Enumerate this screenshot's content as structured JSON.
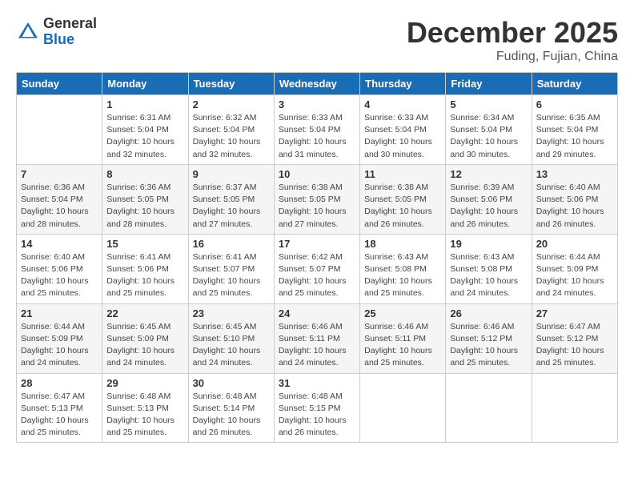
{
  "logo": {
    "general": "General",
    "blue": "Blue"
  },
  "title": "December 2025",
  "subtitle": "Fuding, Fujian, China",
  "days_of_week": [
    "Sunday",
    "Monday",
    "Tuesday",
    "Wednesday",
    "Thursday",
    "Friday",
    "Saturday"
  ],
  "weeks": [
    [
      {
        "day": "",
        "info": ""
      },
      {
        "day": "1",
        "info": "Sunrise: 6:31 AM\nSunset: 5:04 PM\nDaylight: 10 hours\nand 32 minutes."
      },
      {
        "day": "2",
        "info": "Sunrise: 6:32 AM\nSunset: 5:04 PM\nDaylight: 10 hours\nand 32 minutes."
      },
      {
        "day": "3",
        "info": "Sunrise: 6:33 AM\nSunset: 5:04 PM\nDaylight: 10 hours\nand 31 minutes."
      },
      {
        "day": "4",
        "info": "Sunrise: 6:33 AM\nSunset: 5:04 PM\nDaylight: 10 hours\nand 30 minutes."
      },
      {
        "day": "5",
        "info": "Sunrise: 6:34 AM\nSunset: 5:04 PM\nDaylight: 10 hours\nand 30 minutes."
      },
      {
        "day": "6",
        "info": "Sunrise: 6:35 AM\nSunset: 5:04 PM\nDaylight: 10 hours\nand 29 minutes."
      }
    ],
    [
      {
        "day": "7",
        "info": "Sunrise: 6:36 AM\nSunset: 5:04 PM\nDaylight: 10 hours\nand 28 minutes."
      },
      {
        "day": "8",
        "info": "Sunrise: 6:36 AM\nSunset: 5:05 PM\nDaylight: 10 hours\nand 28 minutes."
      },
      {
        "day": "9",
        "info": "Sunrise: 6:37 AM\nSunset: 5:05 PM\nDaylight: 10 hours\nand 27 minutes."
      },
      {
        "day": "10",
        "info": "Sunrise: 6:38 AM\nSunset: 5:05 PM\nDaylight: 10 hours\nand 27 minutes."
      },
      {
        "day": "11",
        "info": "Sunrise: 6:38 AM\nSunset: 5:05 PM\nDaylight: 10 hours\nand 26 minutes."
      },
      {
        "day": "12",
        "info": "Sunrise: 6:39 AM\nSunset: 5:06 PM\nDaylight: 10 hours\nand 26 minutes."
      },
      {
        "day": "13",
        "info": "Sunrise: 6:40 AM\nSunset: 5:06 PM\nDaylight: 10 hours\nand 26 minutes."
      }
    ],
    [
      {
        "day": "14",
        "info": "Sunrise: 6:40 AM\nSunset: 5:06 PM\nDaylight: 10 hours\nand 25 minutes."
      },
      {
        "day": "15",
        "info": "Sunrise: 6:41 AM\nSunset: 5:06 PM\nDaylight: 10 hours\nand 25 minutes."
      },
      {
        "day": "16",
        "info": "Sunrise: 6:41 AM\nSunset: 5:07 PM\nDaylight: 10 hours\nand 25 minutes."
      },
      {
        "day": "17",
        "info": "Sunrise: 6:42 AM\nSunset: 5:07 PM\nDaylight: 10 hours\nand 25 minutes."
      },
      {
        "day": "18",
        "info": "Sunrise: 6:43 AM\nSunset: 5:08 PM\nDaylight: 10 hours\nand 25 minutes."
      },
      {
        "day": "19",
        "info": "Sunrise: 6:43 AM\nSunset: 5:08 PM\nDaylight: 10 hours\nand 24 minutes."
      },
      {
        "day": "20",
        "info": "Sunrise: 6:44 AM\nSunset: 5:09 PM\nDaylight: 10 hours\nand 24 minutes."
      }
    ],
    [
      {
        "day": "21",
        "info": "Sunrise: 6:44 AM\nSunset: 5:09 PM\nDaylight: 10 hours\nand 24 minutes."
      },
      {
        "day": "22",
        "info": "Sunrise: 6:45 AM\nSunset: 5:09 PM\nDaylight: 10 hours\nand 24 minutes."
      },
      {
        "day": "23",
        "info": "Sunrise: 6:45 AM\nSunset: 5:10 PM\nDaylight: 10 hours\nand 24 minutes."
      },
      {
        "day": "24",
        "info": "Sunrise: 6:46 AM\nSunset: 5:11 PM\nDaylight: 10 hours\nand 24 minutes."
      },
      {
        "day": "25",
        "info": "Sunrise: 6:46 AM\nSunset: 5:11 PM\nDaylight: 10 hours\nand 25 minutes."
      },
      {
        "day": "26",
        "info": "Sunrise: 6:46 AM\nSunset: 5:12 PM\nDaylight: 10 hours\nand 25 minutes."
      },
      {
        "day": "27",
        "info": "Sunrise: 6:47 AM\nSunset: 5:12 PM\nDaylight: 10 hours\nand 25 minutes."
      }
    ],
    [
      {
        "day": "28",
        "info": "Sunrise: 6:47 AM\nSunset: 5:13 PM\nDaylight: 10 hours\nand 25 minutes."
      },
      {
        "day": "29",
        "info": "Sunrise: 6:48 AM\nSunset: 5:13 PM\nDaylight: 10 hours\nand 25 minutes."
      },
      {
        "day": "30",
        "info": "Sunrise: 6:48 AM\nSunset: 5:14 PM\nDaylight: 10 hours\nand 26 minutes."
      },
      {
        "day": "31",
        "info": "Sunrise: 6:48 AM\nSunset: 5:15 PM\nDaylight: 10 hours\nand 26 minutes."
      },
      {
        "day": "",
        "info": ""
      },
      {
        "day": "",
        "info": ""
      },
      {
        "day": "",
        "info": ""
      }
    ]
  ]
}
